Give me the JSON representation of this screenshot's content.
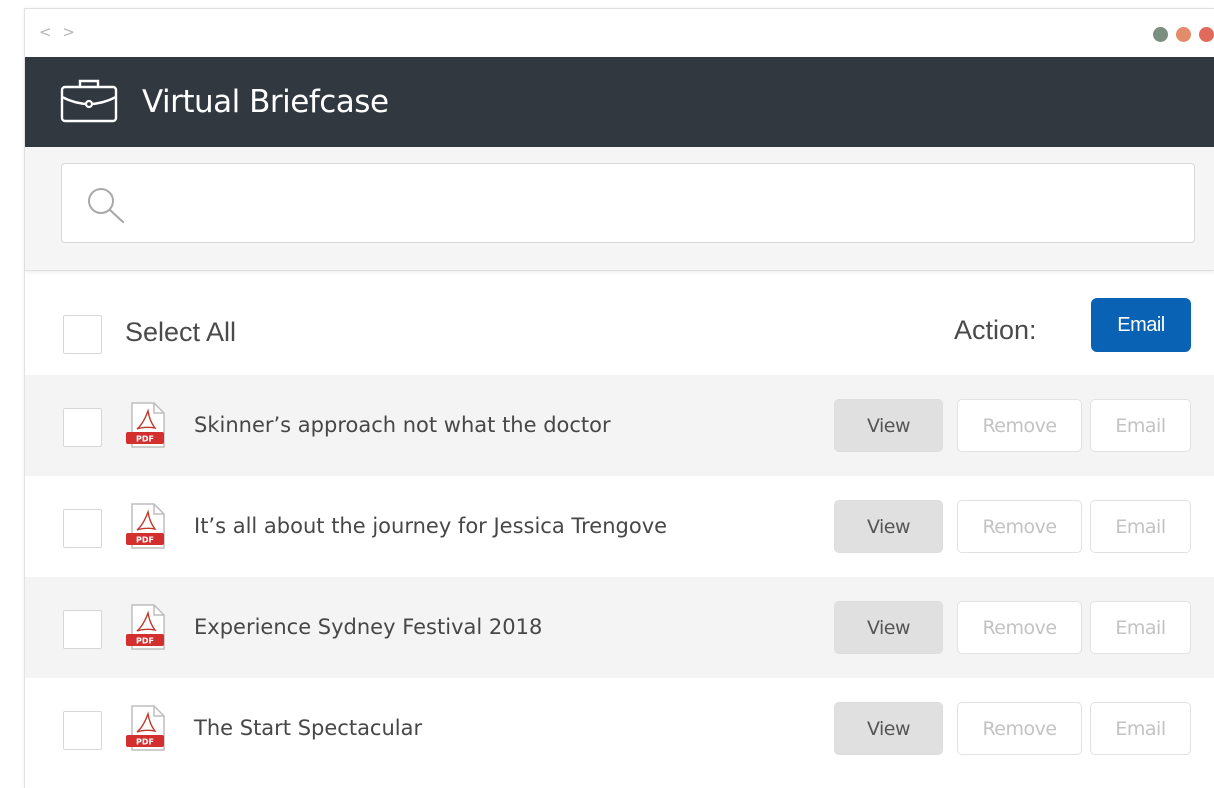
{
  "window": {
    "nav_arrows": "< >",
    "dot_colors": [
      "#7b8f80",
      "#e48b6a",
      "#e06a5c"
    ]
  },
  "header": {
    "title": "Virtual Briefcase",
    "icon": "briefcase-icon",
    "background": "#313840"
  },
  "search": {
    "icon": "search-icon",
    "value": "",
    "placeholder": ""
  },
  "toolbar": {
    "select_all_label": "Select All",
    "action_label": "Action:",
    "email_button_label": "Email",
    "accent": "#0a62b5"
  },
  "documents": [
    {
      "title": "Skinner’s approach not what the doctor",
      "icon": "pdf-file-icon",
      "view_label": "View",
      "remove_label": "Remove",
      "email_label": "Email"
    },
    {
      "title": "It’s all about the journey for Jessica Trengove",
      "icon": "pdf-file-icon",
      "view_label": "View",
      "remove_label": "Remove",
      "email_label": "Email"
    },
    {
      "title": "Experience Sydney Festival 2018",
      "icon": "pdf-file-icon",
      "view_label": "View",
      "remove_label": "Remove",
      "email_label": "Email"
    },
    {
      "title": "The Start Spectacular",
      "icon": "pdf-file-icon",
      "view_label": "View",
      "remove_label": "Remove",
      "email_label": "Email"
    }
  ]
}
